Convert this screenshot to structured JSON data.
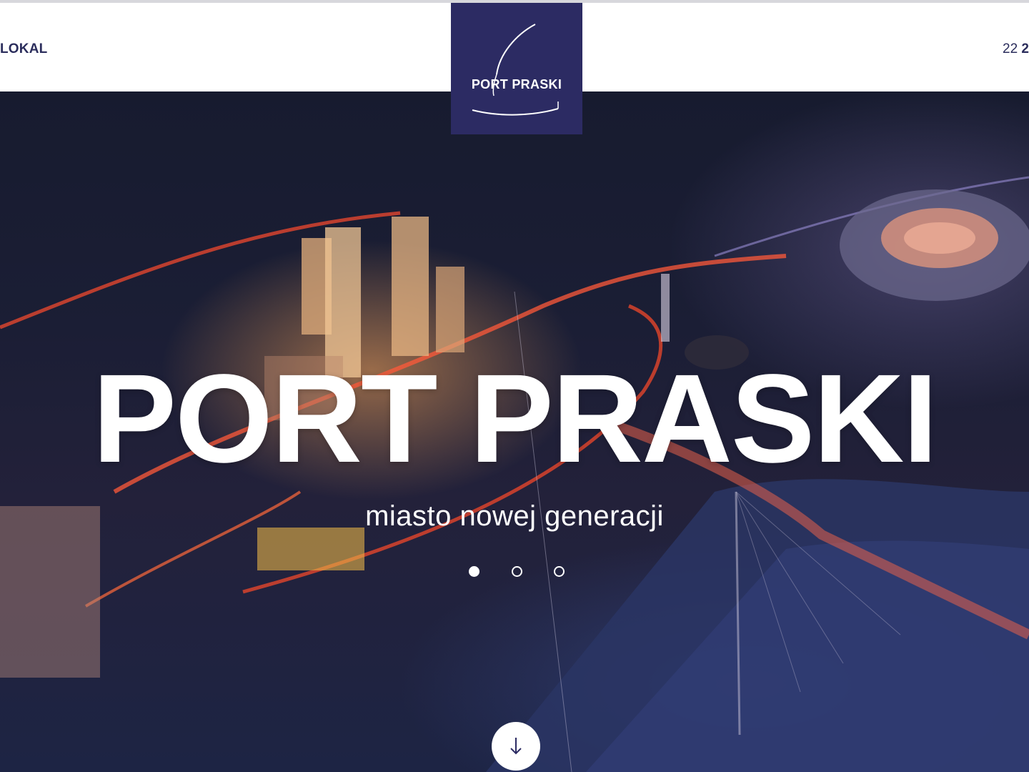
{
  "header": {
    "nav_left_label": "LOKAL",
    "phone_prefix": "22",
    "phone_rest": "2"
  },
  "logo": {
    "text": "PORT PRASKI",
    "background_color": "#2c2b63"
  },
  "hero": {
    "title": "PORT PRASKI",
    "subtitle": "miasto nowej generacji",
    "slides": [
      {
        "active": true
      },
      {
        "active": false
      },
      {
        "active": false
      }
    ],
    "scroll_icon": "arrow-down-icon"
  },
  "colors": {
    "brand": "#2c2b63",
    "nav_text": "#2b2d5c",
    "white": "#ffffff"
  }
}
